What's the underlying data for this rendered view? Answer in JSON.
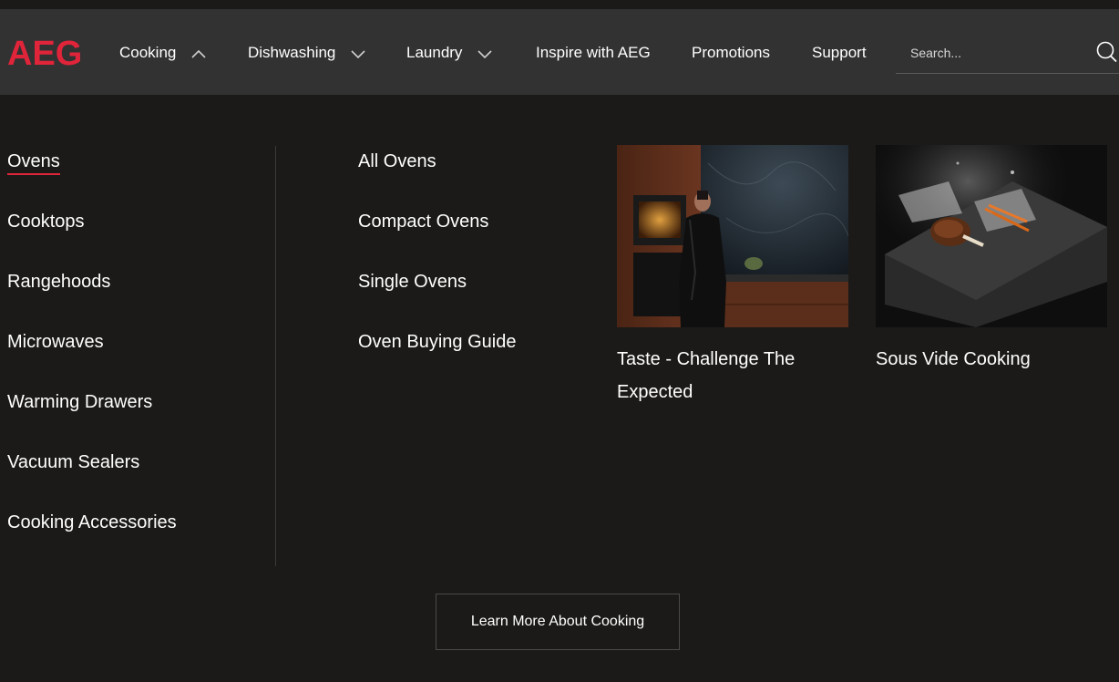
{
  "brand": {
    "logo_text": "AEG",
    "accent_color": "#e0243a"
  },
  "nav": {
    "items": [
      {
        "label": "Cooking",
        "chevron": "chevron-up-icon"
      },
      {
        "label": "Dishwashing",
        "chevron": "chevron-down-icon"
      },
      {
        "label": "Laundry",
        "chevron": "chevron-down-icon"
      },
      {
        "label": "Inspire with AEG"
      },
      {
        "label": "Promotions"
      },
      {
        "label": "Support"
      }
    ]
  },
  "search": {
    "placeholder": "Search...",
    "icon": "search-icon"
  },
  "menu": {
    "categories": [
      {
        "label": "Ovens",
        "active": true
      },
      {
        "label": "Cooktops"
      },
      {
        "label": "Rangehoods"
      },
      {
        "label": "Microwaves"
      },
      {
        "label": "Warming Drawers"
      },
      {
        "label": "Vacuum Sealers"
      },
      {
        "label": "Cooking Accessories"
      }
    ],
    "subcategories": [
      {
        "label": "All Ovens"
      },
      {
        "label": "Compact Ovens"
      },
      {
        "label": "Single Ovens"
      },
      {
        "label": "Oven Buying Guide"
      }
    ],
    "features": [
      {
        "title_line1": "Taste - Challenge The",
        "title_line2": "Expected",
        "image": "woman-in-kitchen-image"
      },
      {
        "title_line1": "Sous Vide Cooking",
        "image": "sous-vide-dish-image"
      }
    ],
    "cta_label": "Learn More About Cooking"
  }
}
